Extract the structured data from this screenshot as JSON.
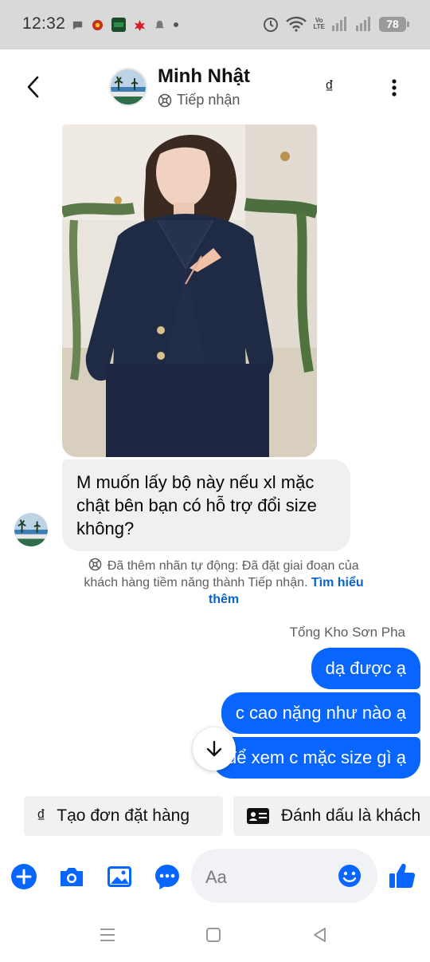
{
  "status_bar": {
    "time": "12:32",
    "network_top": "Vo",
    "network_bottom": "LTE",
    "battery": "78"
  },
  "header": {
    "contact_name": "Minh Nhật",
    "contact_status": "Tiếp nhận",
    "currency_symbol": "₫"
  },
  "messages": {
    "incoming_text": "M muốn lấy bộ này nếu xl mặc chật bên bạn có hỗ trợ đổi size không?",
    "notice_text": "Đã thêm nhãn tự động: Đã đặt giai đoạn của khách hàng tiềm năng thành Tiếp nhận.",
    "notice_link": "Tìm hiểu thêm",
    "sender_label": "Tổng Kho Sơn Pha",
    "outgoing": [
      "dạ được ạ",
      "c cao nặng như nào ạ",
      "để xem c mặc size gì ạ"
    ]
  },
  "quick_actions": {
    "create_order_icon": "₫",
    "create_order": "Tạo đơn đặt hàng",
    "mark_as": "Đánh dấu là khách"
  },
  "composer": {
    "placeholder": "Aa"
  },
  "colors": {
    "accent": "#0866ff",
    "bubble_in": "#f0f0f0",
    "link": "#0a63c9"
  },
  "icons": [
    "back-arrow-icon",
    "more-vert-icon",
    "plus-icon",
    "camera-icon",
    "image-icon",
    "chat-more-icon",
    "emoji-icon",
    "like-icon",
    "arrow-down-icon",
    "contact-card-icon",
    "tag-icon"
  ]
}
